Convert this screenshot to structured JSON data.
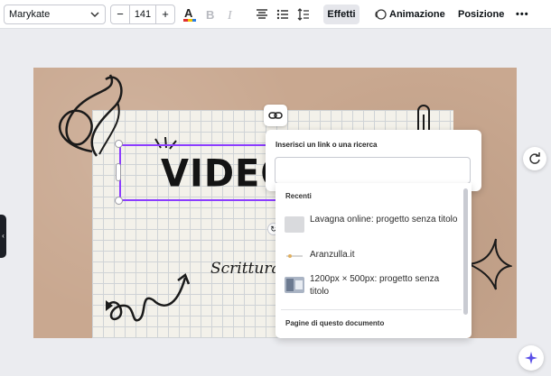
{
  "toolbar": {
    "font_family": "Marykate",
    "font_size": "141",
    "decrement": "−",
    "increment": "+",
    "effects_label": "Effetti",
    "animation_label": "Animazione",
    "position_label": "Posizione",
    "more_label": "•••",
    "icons": [
      "text-color-icon",
      "bold-icon",
      "italic-icon",
      "align-center-icon",
      "list-icon",
      "line-spacing-icon",
      "animation-icon"
    ]
  },
  "canvas": {
    "title_text": "VIDEO",
    "script_text": "Scrittura",
    "colors": {
      "kraft": "#c9a890",
      "paper": "#f3f1ea",
      "selection": "#8b3dff"
    }
  },
  "link_panel": {
    "label": "Inserisci un link o una ricerca",
    "input_value": "",
    "recent_heading": "Recenti",
    "recent_items": [
      {
        "title": "Lavagna online: progetto senza titolo"
      },
      {
        "title": "Aranzulla.it"
      },
      {
        "title": "1200px × 500px: progetto senza titolo"
      }
    ],
    "pages_heading": "Pagine di questo documento"
  },
  "side_tab_glyph": "‹"
}
